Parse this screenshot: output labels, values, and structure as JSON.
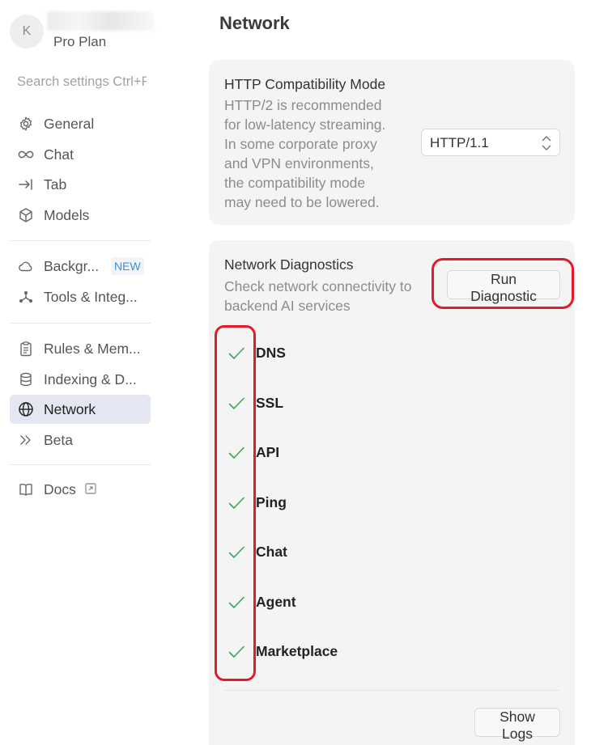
{
  "sidebar": {
    "avatar_letter": "K",
    "plan": "Pro Plan",
    "search_placeholder": "Search settings Ctrl+F",
    "groups": [
      [
        {
          "label": "General",
          "icon": "gear-icon"
        },
        {
          "label": "Chat",
          "icon": "infinity-icon"
        },
        {
          "label": "Tab",
          "icon": "tab-arrow-icon"
        },
        {
          "label": "Models",
          "icon": "cube-icon"
        }
      ],
      [
        {
          "label": "Backgr...",
          "icon": "cloud-icon",
          "badge": "NEW"
        },
        {
          "label": "Tools & Integ...",
          "icon": "nodes-icon"
        }
      ],
      [
        {
          "label": "Rules & Mem...",
          "icon": "clipboard-icon"
        },
        {
          "label": "Indexing & D...",
          "icon": "database-icon"
        },
        {
          "label": "Network",
          "icon": "globe-icon",
          "active": true
        },
        {
          "label": "Beta",
          "icon": "double-chevron-icon"
        }
      ],
      [
        {
          "label": "Docs",
          "icon": "book-icon",
          "external": true
        }
      ]
    ]
  },
  "main": {
    "title": "Network",
    "http": {
      "title": "HTTP Compatibility Mode",
      "description_lines": [
        "HTTP/2 is recommended",
        "for low-latency streaming.",
        "In some corporate proxy",
        "and VPN environments,",
        "the compatibility mode",
        "may need to be lowered."
      ],
      "selected": "HTTP/1.1"
    },
    "diagnostics": {
      "title": "Network Diagnostics",
      "description_lines": [
        "Check network connectivity to",
        "backend AI services"
      ],
      "run_button": "Run Diagnostic",
      "checks": [
        {
          "label": "DNS",
          "status": "pass"
        },
        {
          "label": "SSL",
          "status": "pass"
        },
        {
          "label": "API",
          "status": "pass"
        },
        {
          "label": "Ping",
          "status": "pass"
        },
        {
          "label": "Chat",
          "status": "pass"
        },
        {
          "label": "Agent",
          "status": "pass"
        },
        {
          "label": "Marketplace",
          "status": "pass"
        }
      ],
      "logs_button": "Show Logs"
    }
  },
  "colors": {
    "accent_active": "#e4e6f2",
    "check_green": "#3aa655",
    "annotation_red": "#e5192a",
    "new_badge": "#3a8fd6"
  }
}
